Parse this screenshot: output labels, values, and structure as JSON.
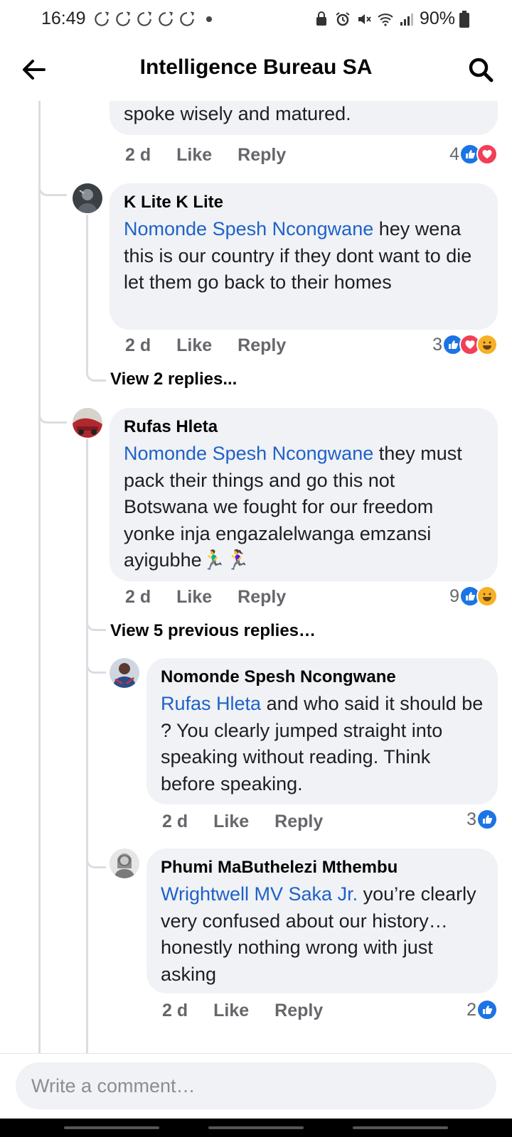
{
  "status_bar": {
    "time": "16:49",
    "battery": "90%",
    "notification_icons": [
      "sync-icon",
      "sync-icon",
      "sync-icon",
      "sync-icon",
      "sync-icon"
    ]
  },
  "header": {
    "title": "Intelligence Bureau SA",
    "back_icon": "arrow-left-icon",
    "search_icon": "search-icon"
  },
  "comments": [
    {
      "id": "c0",
      "author": "",
      "mention": "",
      "text": "spoke wisely and matured.",
      "time": "2 d",
      "like_label": "Like",
      "reply_label": "Reply",
      "reaction_count": "4",
      "reactions": [
        "like",
        "love"
      ]
    },
    {
      "id": "c1",
      "author": "K Lite K Lite",
      "mention": "Nomonde Spesh Ncongwane",
      "text": " hey wena this is our country if they dont want to die let them go back to their homes",
      "time": "2 d",
      "like_label": "Like",
      "reply_label": "Reply",
      "reaction_count": "3",
      "reactions": [
        "like",
        "love",
        "haha"
      ]
    },
    {
      "id": "c2",
      "author": "Rufas Hleta",
      "mention": "Nomonde Spesh Ncongwane",
      "text": " they must pack their things and go this not Botswana we fought for our freedom yonke inja engazalelwanga emzansi ayigubhe🏃‍♂️🏃‍♀️",
      "time": "2 d",
      "like_label": "Like",
      "reply_label": "Reply",
      "reaction_count": "9",
      "reactions": [
        "like",
        "haha"
      ]
    },
    {
      "id": "c3",
      "author": "Nomonde Spesh Ncongwane",
      "mention": "Rufas Hleta",
      "text": " and who said it should be ? You clearly jumped straight into speaking without reading. Think before speaking.",
      "time": "2 d",
      "like_label": "Like",
      "reply_label": "Reply",
      "reaction_count": "3",
      "reactions": [
        "like"
      ]
    },
    {
      "id": "c4",
      "author": "Phumi MaButhelezi Mthembu",
      "mention": "Wrightwell MV Saka Jr.",
      "text": " you’re clearly very confused about our history…honestly nothing wrong with just asking",
      "time": "2 d",
      "like_label": "Like",
      "reply_label": "Reply",
      "reaction_count": "2",
      "reactions": [
        "like"
      ]
    }
  ],
  "view_links": {
    "view_2_replies": "View 2 replies...",
    "view_5_previous": "View 5 previous replies…"
  },
  "composer": {
    "placeholder": "Write a comment…",
    "value": ""
  },
  "colors": {
    "mention": "#1f61c9",
    "bubble": "#f0f2f5",
    "like": "#1b74e4",
    "love": "#f33e58",
    "haha": "#f7b125"
  }
}
